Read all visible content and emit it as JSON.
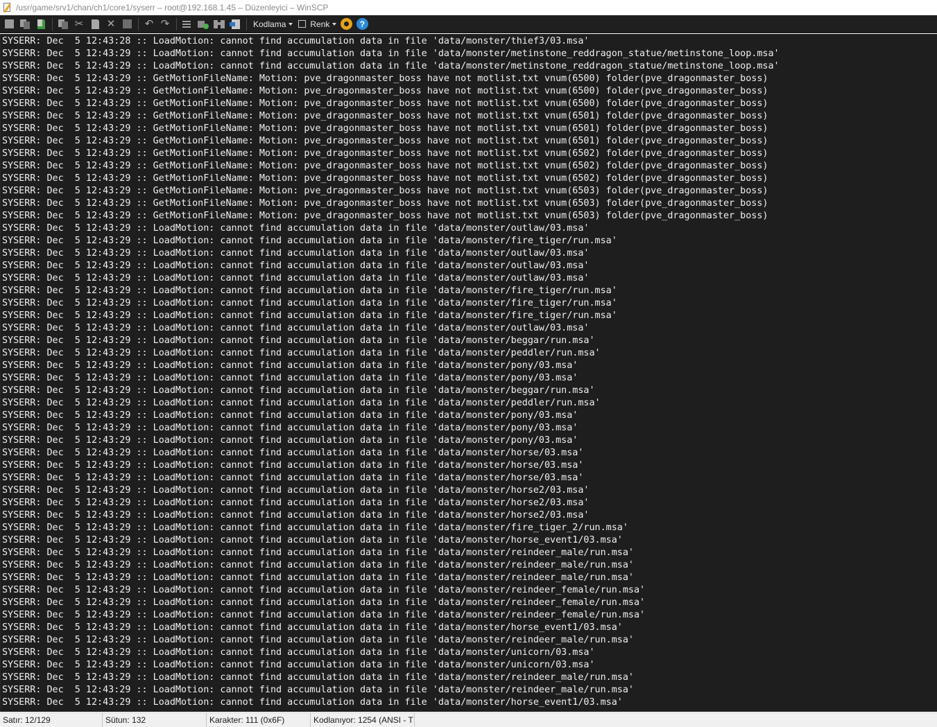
{
  "window": {
    "title": "/usr/game/srv1/chan/ch1/core1/syserr – root@192.168.1.45 – Düzenleyici – WinSCP"
  },
  "toolbar": {
    "encoding_label": "Kodlama",
    "color_label": "Renk",
    "help_glyph": "?",
    "icons": [
      "save-icon",
      "save-all-icon",
      "reload-icon",
      "copy-icon",
      "cut-icon",
      "paste-icon",
      "delete-icon",
      "select-all-icon",
      "undo-icon",
      "redo-icon",
      "find-icon",
      "replace-icon",
      "find-next-icon",
      "go-to-line-icon",
      "settings-icon",
      "help-icon"
    ]
  },
  "editor": {
    "lines": [
      "SYSERR: Dec  5 12:43:28 :: LoadMotion: cannot find accumulation data in file 'data/monster/thief3/03.msa'",
      "SYSERR: Dec  5 12:43:29 :: LoadMotion: cannot find accumulation data in file 'data/monster/metinstone_reddragon_statue/metinstone_loop.msa'",
      "SYSERR: Dec  5 12:43:29 :: LoadMotion: cannot find accumulation data in file 'data/monster/metinstone_reddragon_statue/metinstone_loop.msa'",
      "SYSERR: Dec  5 12:43:29 :: GetMotionFileName: Motion: pve_dragonmaster_boss have not motlist.txt vnum(6500) folder(pve_dragonmaster_boss)",
      "SYSERR: Dec  5 12:43:29 :: GetMotionFileName: Motion: pve_dragonmaster_boss have not motlist.txt vnum(6500) folder(pve_dragonmaster_boss)",
      "SYSERR: Dec  5 12:43:29 :: GetMotionFileName: Motion: pve_dragonmaster_boss have not motlist.txt vnum(6500) folder(pve_dragonmaster_boss)",
      "SYSERR: Dec  5 12:43:29 :: GetMotionFileName: Motion: pve_dragonmaster_boss have not motlist.txt vnum(6501) folder(pve_dragonmaster_boss)",
      "SYSERR: Dec  5 12:43:29 :: GetMotionFileName: Motion: pve_dragonmaster_boss have not motlist.txt vnum(6501) folder(pve_dragonmaster_boss)",
      "SYSERR: Dec  5 12:43:29 :: GetMotionFileName: Motion: pve_dragonmaster_boss have not motlist.txt vnum(6501) folder(pve_dragonmaster_boss)",
      "SYSERR: Dec  5 12:43:29 :: GetMotionFileName: Motion: pve_dragonmaster_boss have not motlist.txt vnum(6502) folder(pve_dragonmaster_boss)",
      "SYSERR: Dec  5 12:43:29 :: GetMotionFileName: Motion: pve_dragonmaster_boss have not motlist.txt vnum(6502) folder(pve_dragonmaster_boss)",
      "SYSERR: Dec  5 12:43:29 :: GetMotionFileName: Motion: pve_dragonmaster_boss have not motlist.txt vnum(6502) folder(pve_dragonmaster_boss)",
      "SYSERR: Dec  5 12:43:29 :: GetMotionFileName: Motion: pve_dragonmaster_boss have not motlist.txt vnum(6503) folder(pve_dragonmaster_boss)",
      "SYSERR: Dec  5 12:43:29 :: GetMotionFileName: Motion: pve_dragonmaster_boss have not motlist.txt vnum(6503) folder(pve_dragonmaster_boss)",
      "SYSERR: Dec  5 12:43:29 :: GetMotionFileName: Motion: pve_dragonmaster_boss have not motlist.txt vnum(6503) folder(pve_dragonmaster_boss)",
      "SYSERR: Dec  5 12:43:29 :: LoadMotion: cannot find accumulation data in file 'data/monster/outlaw/03.msa'",
      "SYSERR: Dec  5 12:43:29 :: LoadMotion: cannot find accumulation data in file 'data/monster/fire_tiger/run.msa'",
      "SYSERR: Dec  5 12:43:29 :: LoadMotion: cannot find accumulation data in file 'data/monster/outlaw/03.msa'",
      "SYSERR: Dec  5 12:43:29 :: LoadMotion: cannot find accumulation data in file 'data/monster/outlaw/03.msa'",
      "SYSERR: Dec  5 12:43:29 :: LoadMotion: cannot find accumulation data in file 'data/monster/outlaw/03.msa'",
      "SYSERR: Dec  5 12:43:29 :: LoadMotion: cannot find accumulation data in file 'data/monster/fire_tiger/run.msa'",
      "SYSERR: Dec  5 12:43:29 :: LoadMotion: cannot find accumulation data in file 'data/monster/fire_tiger/run.msa'",
      "SYSERR: Dec  5 12:43:29 :: LoadMotion: cannot find accumulation data in file 'data/monster/fire_tiger/run.msa'",
      "SYSERR: Dec  5 12:43:29 :: LoadMotion: cannot find accumulation data in file 'data/monster/outlaw/03.msa'",
      "SYSERR: Dec  5 12:43:29 :: LoadMotion: cannot find accumulation data in file 'data/monster/beggar/run.msa'",
      "SYSERR: Dec  5 12:43:29 :: LoadMotion: cannot find accumulation data in file 'data/monster/peddler/run.msa'",
      "SYSERR: Dec  5 12:43:29 :: LoadMotion: cannot find accumulation data in file 'data/monster/pony/03.msa'",
      "SYSERR: Dec  5 12:43:29 :: LoadMotion: cannot find accumulation data in file 'data/monster/pony/03.msa'",
      "SYSERR: Dec  5 12:43:29 :: LoadMotion: cannot find accumulation data in file 'data/monster/beggar/run.msa'",
      "SYSERR: Dec  5 12:43:29 :: LoadMotion: cannot find accumulation data in file 'data/monster/peddler/run.msa'",
      "SYSERR: Dec  5 12:43:29 :: LoadMotion: cannot find accumulation data in file 'data/monster/pony/03.msa'",
      "SYSERR: Dec  5 12:43:29 :: LoadMotion: cannot find accumulation data in file 'data/monster/pony/03.msa'",
      "SYSERR: Dec  5 12:43:29 :: LoadMotion: cannot find accumulation data in file 'data/monster/pony/03.msa'",
      "SYSERR: Dec  5 12:43:29 :: LoadMotion: cannot find accumulation data in file 'data/monster/horse/03.msa'",
      "SYSERR: Dec  5 12:43:29 :: LoadMotion: cannot find accumulation data in file 'data/monster/horse/03.msa'",
      "SYSERR: Dec  5 12:43:29 :: LoadMotion: cannot find accumulation data in file 'data/monster/horse/03.msa'",
      "SYSERR: Dec  5 12:43:29 :: LoadMotion: cannot find accumulation data in file 'data/monster/horse2/03.msa'",
      "SYSERR: Dec  5 12:43:29 :: LoadMotion: cannot find accumulation data in file 'data/monster/horse2/03.msa'",
      "SYSERR: Dec  5 12:43:29 :: LoadMotion: cannot find accumulation data in file 'data/monster/horse2/03.msa'",
      "SYSERR: Dec  5 12:43:29 :: LoadMotion: cannot find accumulation data in file 'data/monster/fire_tiger_2/run.msa'",
      "SYSERR: Dec  5 12:43:29 :: LoadMotion: cannot find accumulation data in file 'data/monster/horse_event1/03.msa'",
      "SYSERR: Dec  5 12:43:29 :: LoadMotion: cannot find accumulation data in file 'data/monster/reindeer_male/run.msa'",
      "SYSERR: Dec  5 12:43:29 :: LoadMotion: cannot find accumulation data in file 'data/monster/reindeer_male/run.msa'",
      "SYSERR: Dec  5 12:43:29 :: LoadMotion: cannot find accumulation data in file 'data/monster/reindeer_male/run.msa'",
      "SYSERR: Dec  5 12:43:29 :: LoadMotion: cannot find accumulation data in file 'data/monster/reindeer_female/run.msa'",
      "SYSERR: Dec  5 12:43:29 :: LoadMotion: cannot find accumulation data in file 'data/monster/reindeer_female/run.msa'",
      "SYSERR: Dec  5 12:43:29 :: LoadMotion: cannot find accumulation data in file 'data/monster/reindeer_female/run.msa'",
      "SYSERR: Dec  5 12:43:29 :: LoadMotion: cannot find accumulation data in file 'data/monster/horse_event1/03.msa'",
      "SYSERR: Dec  5 12:43:29 :: LoadMotion: cannot find accumulation data in file 'data/monster/reindeer_male/run.msa'",
      "SYSERR: Dec  5 12:43:29 :: LoadMotion: cannot find accumulation data in file 'data/monster/unicorn/03.msa'",
      "SYSERR: Dec  5 12:43:29 :: LoadMotion: cannot find accumulation data in file 'data/monster/unicorn/03.msa'",
      "SYSERR: Dec  5 12:43:29 :: LoadMotion: cannot find accumulation data in file 'data/monster/reindeer_male/run.msa'",
      "SYSERR: Dec  5 12:43:29 :: LoadMotion: cannot find accumulation data in file 'data/monster/reindeer_male/run.msa'",
      "SYSERR: Dec  5 12:43:29 :: LoadMotion: cannot find accumulation data in file 'data/monster/horse_event1/03.msa'"
    ]
  },
  "statusbar": {
    "line": "Satır: 12/129",
    "column": "Sütun: 132",
    "character": "Karakter: 111 (0x6F)",
    "encoding": "Kodlanıyor: 1254  (ANSI - T"
  },
  "colors": {
    "editor_bg": "#1e1e1e",
    "editor_fg": "#f0f0f0",
    "toolbar_bg": "#1f1f1f",
    "statusbar_bg": "#f0f0f0",
    "settings_accent": "#e5a21b",
    "help_accent": "#2b8ad8"
  }
}
